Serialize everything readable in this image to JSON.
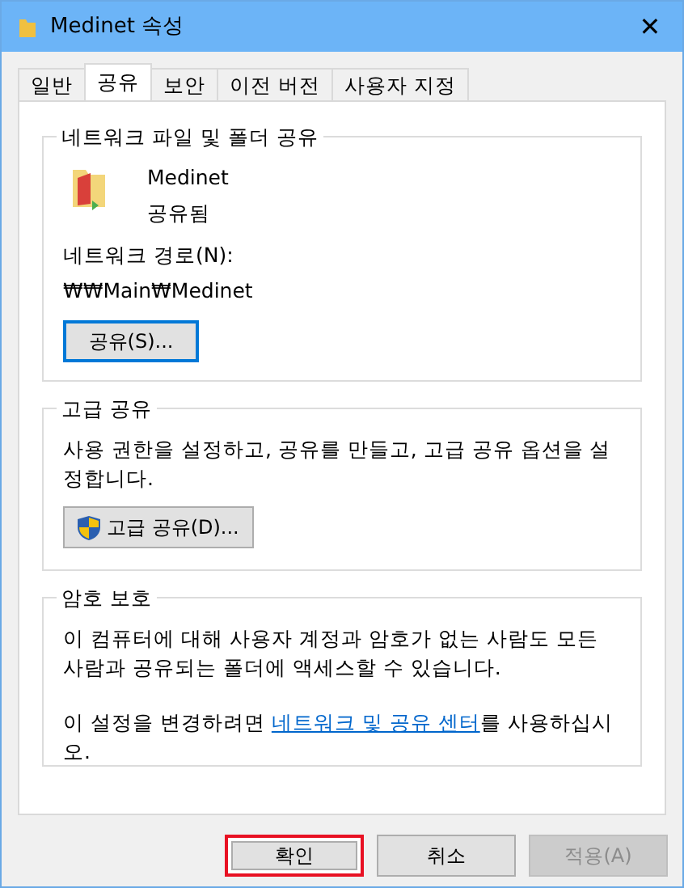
{
  "window": {
    "title": "Medinet 속성",
    "close": "✕"
  },
  "tabs": [
    {
      "label": "일반",
      "selected": false
    },
    {
      "label": "공유",
      "selected": true
    },
    {
      "label": "보안",
      "selected": false
    },
    {
      "label": "이전 버전",
      "selected": false
    },
    {
      "label": "사용자 지정",
      "selected": false
    }
  ],
  "network_sharing": {
    "title": "네트워크 파일 및 폴더 공유",
    "folder_name": "Medinet",
    "status": "공유됨",
    "path_label": "네트워크 경로(N):",
    "path": "₩₩Main₩Medinet",
    "button": "공유(S)..."
  },
  "advanced_sharing": {
    "title": "고급 공유",
    "description": "사용 권한을 설정하고, 공유를 만들고, 고급 공유 옵션을 설정합니다.",
    "button": "고급 공유(D)..."
  },
  "password_protection": {
    "title": "암호 보호",
    "description": "이 컴퓨터에 대해 사용자 계정과 암호가 없는 사람도 모든 사람과 공유되는 폴더에 액세스할 수 있습니다.",
    "link_prefix": "이 설정을 변경하려면 ",
    "link": "네트워크 및 공유 센터",
    "link_suffix": "를 사용하십시오."
  },
  "buttons": [
    {
      "label": "확인",
      "disabled": false,
      "highlighted": true
    },
    {
      "label": "취소",
      "disabled": false,
      "highlighted": false
    },
    {
      "label": "적용(A)",
      "disabled": true,
      "highlighted": false
    }
  ]
}
